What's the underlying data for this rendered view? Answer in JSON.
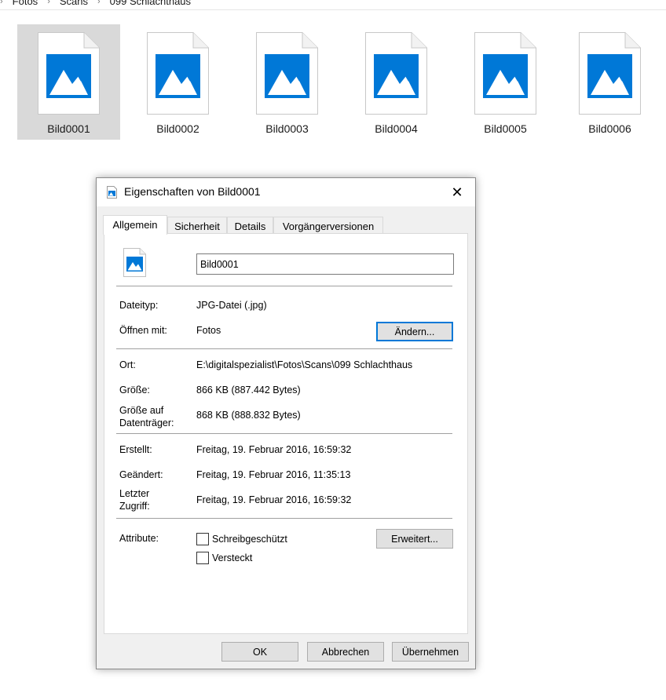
{
  "breadcrumb": {
    "items": [
      "Fotos",
      "Scans",
      "099 Schlachthaus"
    ]
  },
  "files": [
    {
      "name": "Bild0001",
      "selected": true
    },
    {
      "name": "Bild0002",
      "selected": false
    },
    {
      "name": "Bild0003",
      "selected": false
    },
    {
      "name": "Bild0004",
      "selected": false
    },
    {
      "name": "Bild0005",
      "selected": false
    },
    {
      "name": "Bild0006",
      "selected": false
    }
  ],
  "dialog": {
    "title": "Eigenschaften von Bild0001",
    "close_glyph": "✕",
    "tabs": [
      "Allgemein",
      "Sicherheit",
      "Details",
      "Vorgängerversionen"
    ],
    "active_tab": "Allgemein",
    "name_value": "Bild0001",
    "rows": {
      "dateityp_label": "Dateityp:",
      "dateityp_value": "JPG-Datei (.jpg)",
      "oeffnen_label": "Öffnen mit:",
      "oeffnen_value": "Fotos",
      "aendern_button": "Ändern...",
      "ort_label": "Ort:",
      "ort_value": "E:\\digitalspezialist\\Fotos\\Scans\\099 Schlachthaus",
      "groesse_label": "Größe:",
      "groesse_value": "866 KB (887.442 Bytes)",
      "groesse_auf_label_1": "Größe auf",
      "groesse_auf_label_2": "Datenträger:",
      "groesse_auf_value": "868 KB (888.832 Bytes)",
      "erstellt_label": "Erstellt:",
      "erstellt_value": "Freitag, 19. Februar 2016, 16:59:32",
      "geaendert_label": "Geändert:",
      "geaendert_value": "Freitag, 19. Februar 2016, 11:35:13",
      "letzter_label_1": "Letzter",
      "letzter_label_2": "Zugriff:",
      "letzter_value": "Freitag, 19. Februar 2016, 16:59:32",
      "attribute_label": "Attribute:",
      "schreibgeschuetzt_label": "Schreibgeschützt",
      "versteckt_label": "Versteckt",
      "erweitert_button": "Erweitert..."
    },
    "buttons": {
      "ok": "OK",
      "abbrechen": "Abbrechen",
      "uebernehmen": "Übernehmen"
    }
  },
  "colors": {
    "accent": "#0078d7",
    "selection": "#d9d9d9",
    "image_icon_blue": "#0078d7"
  }
}
